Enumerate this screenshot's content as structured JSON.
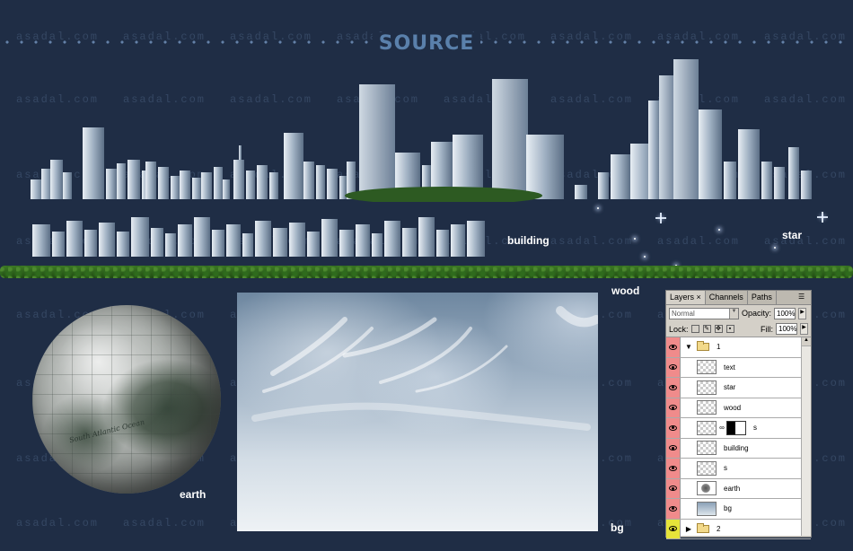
{
  "watermark": "asadal.com",
  "title": "SOURCE",
  "labels": {
    "building": "building",
    "star": "star",
    "wood": "wood",
    "earth": "earth",
    "bg": "bg"
  },
  "earth_map_text": "South Atlantic Ocean",
  "layers_panel": {
    "tabs": [
      "Layers ×",
      "Channels",
      "Paths"
    ],
    "active_tab": "Layers ×",
    "blend_mode": "Normal",
    "opacity_label": "Opacity:",
    "opacity_value": "100%",
    "lock_label": "Lock:",
    "fill_label": "Fill:",
    "fill_value": "100%",
    "layers": [
      {
        "name": "1",
        "type": "group-open"
      },
      {
        "name": "text",
        "type": "layer"
      },
      {
        "name": "star",
        "type": "layer"
      },
      {
        "name": "wood",
        "type": "layer"
      },
      {
        "name": "s",
        "type": "masked"
      },
      {
        "name": "building",
        "type": "layer"
      },
      {
        "name": "s",
        "type": "layer"
      },
      {
        "name": "earth",
        "type": "earth"
      },
      {
        "name": "bg",
        "type": "bg"
      },
      {
        "name": "2",
        "type": "group-closed"
      }
    ]
  },
  "colors": {
    "background": "#1f2d45",
    "title": "#5a80ab",
    "eye_column": "#f08b8b",
    "eye_column_last": "#e6e43a"
  }
}
